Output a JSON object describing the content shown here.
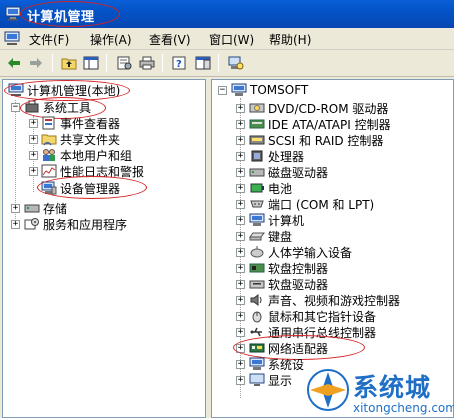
{
  "window": {
    "title": "计算机管理"
  },
  "menu": {
    "items": [
      "文件(F)",
      "操作(A)",
      "查看(V)",
      "窗口(W)",
      "帮助(H)"
    ]
  },
  "left_tree": {
    "root": "计算机管理(本地)",
    "system_tools": "系统工具",
    "system_tools_children": [
      "事件查看器",
      "共享文件夹",
      "本地用户和组",
      "性能日志和警报",
      "设备管理器"
    ],
    "storage": "存储",
    "services": "服务和应用程序"
  },
  "right_tree": {
    "root": "TOMSOFT",
    "devices": [
      "DVD/CD-ROM 驱动器",
      "IDE ATA/ATAPI 控制器",
      "SCSI 和 RAID 控制器",
      "处理器",
      "磁盘驱动器",
      "电池",
      "端口 (COM 和 LPT)",
      "计算机",
      "键盘",
      "人体学输入设备",
      "软盘控制器",
      "软盘驱动器",
      "声音、视频和游戏控制器",
      "鼠标和其它指针设备",
      "通用串行总线控制器",
      "网络适配器",
      "系统设",
      "显示"
    ]
  },
  "watermark": {
    "brand": "系统城",
    "url": "xitongcheng.com"
  },
  "colors": {
    "titlebar": "#0453c7",
    "highlight": "#d42222",
    "selection": "#316ac5",
    "watermark": "#1f6fc7"
  }
}
